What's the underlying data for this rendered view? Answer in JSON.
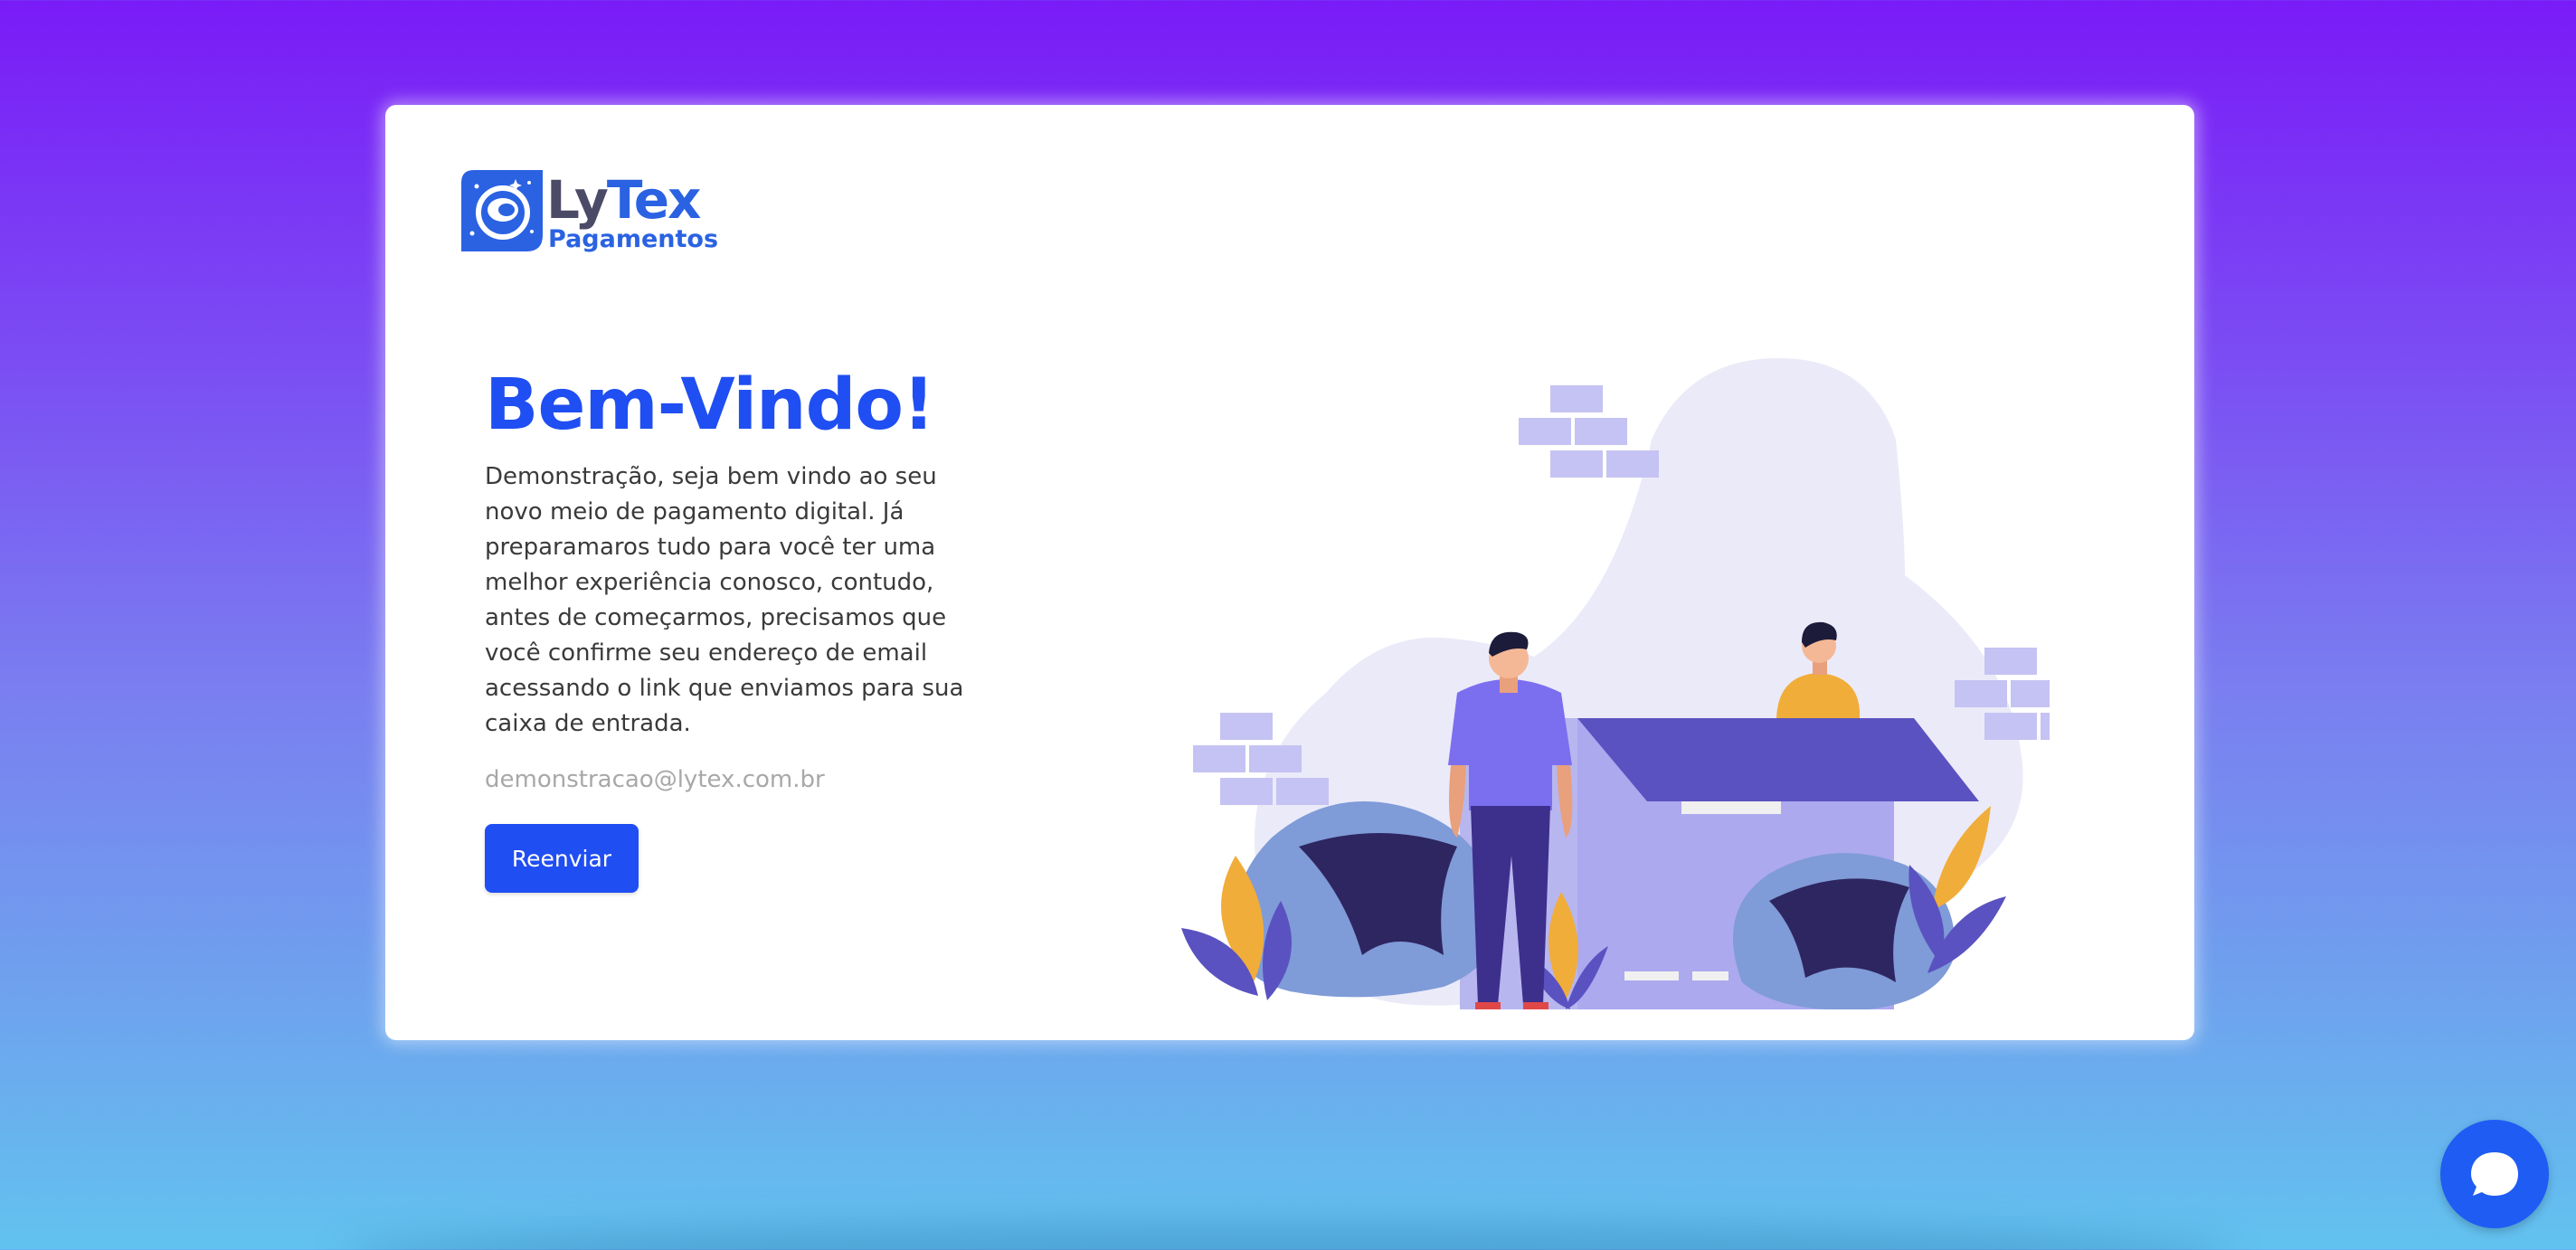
{
  "brand": {
    "name_part1": "Ly",
    "name_part2": "Tex",
    "subtitle": "Pagamentos",
    "primary_color": "#1f4ef2",
    "logo_color": "#2a62e2"
  },
  "main": {
    "title": "Bem-Vindo!",
    "description": "Demonstração, seja bem vindo ao seu novo meio de pagamento digital. Já preparamaros tudo para você ter uma melhor experiência conosco, contudo, antes de começarmos, precisamos que você confirme seu endereço de email acessando o link que enviamos para sua caixa de entrada.",
    "email": "demonstracao@lytex.com.br",
    "resend_label": "Reenviar"
  },
  "background": {
    "gradient_top": "#7a1bf7",
    "gradient_bottom": "#62c2ef"
  },
  "icons": {
    "chat": "chat-bubble-icon",
    "logo": "astronaut-logo-icon"
  }
}
